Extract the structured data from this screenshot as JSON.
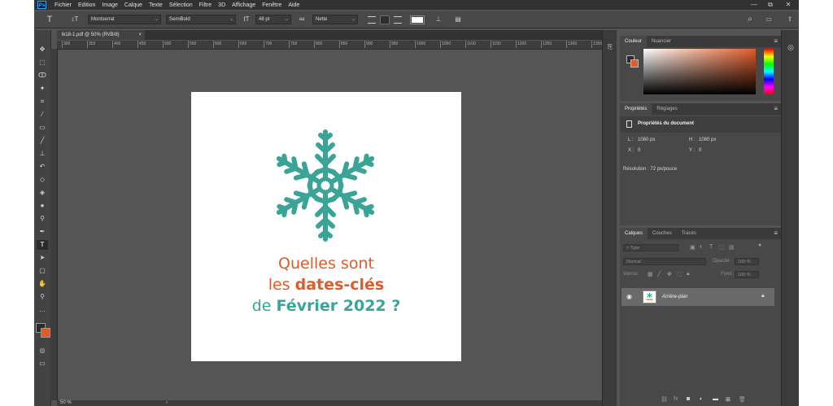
{
  "app": {
    "logo": "Ps"
  },
  "menu": [
    "Fichier",
    "Edition",
    "Image",
    "Calque",
    "Texte",
    "Sélection",
    "Filtre",
    "3D",
    "Affichage",
    "Fenêtre",
    "Aide"
  ],
  "window_controls": {
    "minimize": "—",
    "restore": "⧉",
    "close": "✕"
  },
  "options": {
    "tool_icon": "T",
    "orient_icon": "↕T",
    "font_family": "Montserrat",
    "font_style": "SemiBold",
    "size_icon": "tT",
    "font_size": "48 pt",
    "aa_icon": "aa",
    "antialias": "Nette",
    "warp_icon": "⊥",
    "panels_icon": "▤",
    "search_icon": "⌕",
    "workspace_icon": "▭",
    "share_icon": "⇪",
    "text_color": "#ffffff"
  },
  "document": {
    "tab_label": "lk18-1.pdf @ 50% (RVB/8)",
    "close": "×"
  },
  "ruler_ticks": [
    "300",
    "350",
    "400",
    "450",
    "500",
    "550",
    "600",
    "650",
    "700",
    "750",
    "800",
    "850",
    "900",
    "950",
    "1000",
    "1050",
    "1100",
    "1150",
    "1200",
    "1250",
    "1300",
    "1350",
    "1400",
    "1450",
    "1500"
  ],
  "canvas": {
    "line1": "Quelles sont",
    "line2_a": "les ",
    "line2_b": "dates-clés",
    "line3_a": "de ",
    "line3_b": "Février 2022 ?",
    "orange": "#e15a28",
    "teal": "#3aa596"
  },
  "status": {
    "zoom": "50 %",
    "arrow": "›"
  },
  "color_panel": {
    "tabs": [
      "Couleur",
      "Nuancier"
    ],
    "foreground": "#2b2b2b",
    "background": "#e15a28"
  },
  "properties_panel": {
    "tabs": [
      "Propriétés",
      "Réglages"
    ],
    "title": "Propriétés du document",
    "L_label": "L :",
    "L": "1080 px",
    "H_label": "H :",
    "H": "1080 px",
    "X_label": "X :",
    "X": "0",
    "Y_label": "Y :",
    "Y": "0",
    "resolution": "Résolution : 72 px/pouce"
  },
  "layers_panel": {
    "tabs": [
      "Calques",
      "Couches",
      "Tracés"
    ],
    "filter_placeholder": "Type",
    "blend_mode": "Normal",
    "opacity_label": "Opacité :",
    "opacity": "100 %",
    "lock_label": "Verrou :",
    "fill_label": "Fond :",
    "fill": "100 %",
    "layer_name": "Arrière-plan"
  }
}
